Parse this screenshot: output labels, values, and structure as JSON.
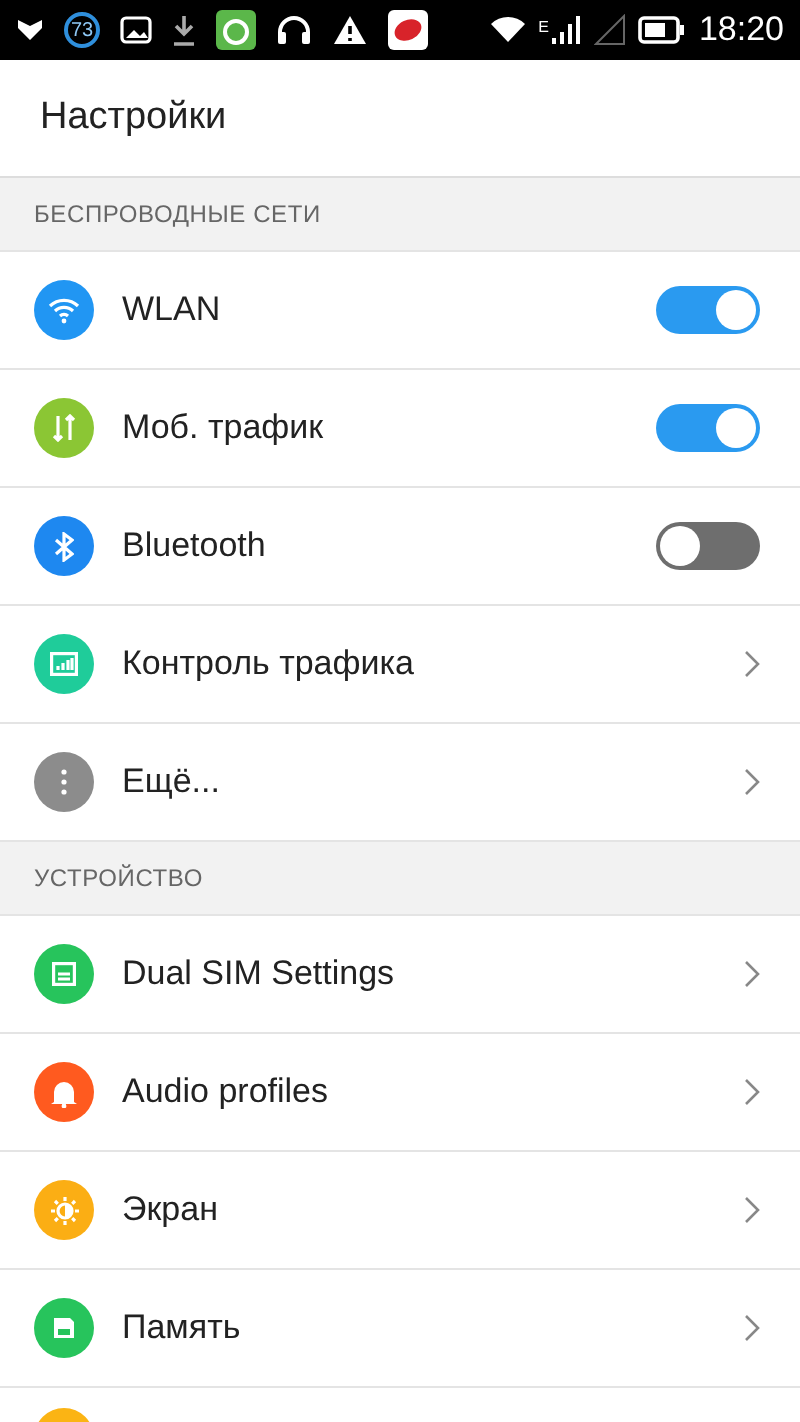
{
  "status_bar": {
    "notification_count": "73",
    "network_type": "E",
    "time": "18:20"
  },
  "title": "Настройки",
  "sections": [
    {
      "header": "БЕСПРОВОДНЫЕ СЕТИ",
      "items": [
        {
          "kind": "toggle",
          "label": "WLAN",
          "color": "#2196f3",
          "on": true
        },
        {
          "kind": "toggle",
          "label": "Моб. трафик",
          "color": "#8bc634",
          "on": true
        },
        {
          "kind": "toggle",
          "label": "Bluetooth",
          "color": "#1e88f0",
          "on": false
        },
        {
          "kind": "link",
          "label": "Контроль трафика",
          "color": "#1fcc9a"
        },
        {
          "kind": "link",
          "label": "Ещё...",
          "color": "#8c8c8c"
        }
      ]
    },
    {
      "header": "УСТРОЙСТВО",
      "items": [
        {
          "kind": "link",
          "label": "Dual SIM Settings",
          "color": "#27c45c"
        },
        {
          "kind": "link",
          "label": "Audio profiles",
          "color": "#ff5a1f"
        },
        {
          "kind": "link",
          "label": "Экран",
          "color": "#fbae14"
        },
        {
          "kind": "link",
          "label": "Память",
          "color": "#27c45c"
        },
        {
          "kind": "partial",
          "color": "#fbb414"
        }
      ]
    }
  ]
}
